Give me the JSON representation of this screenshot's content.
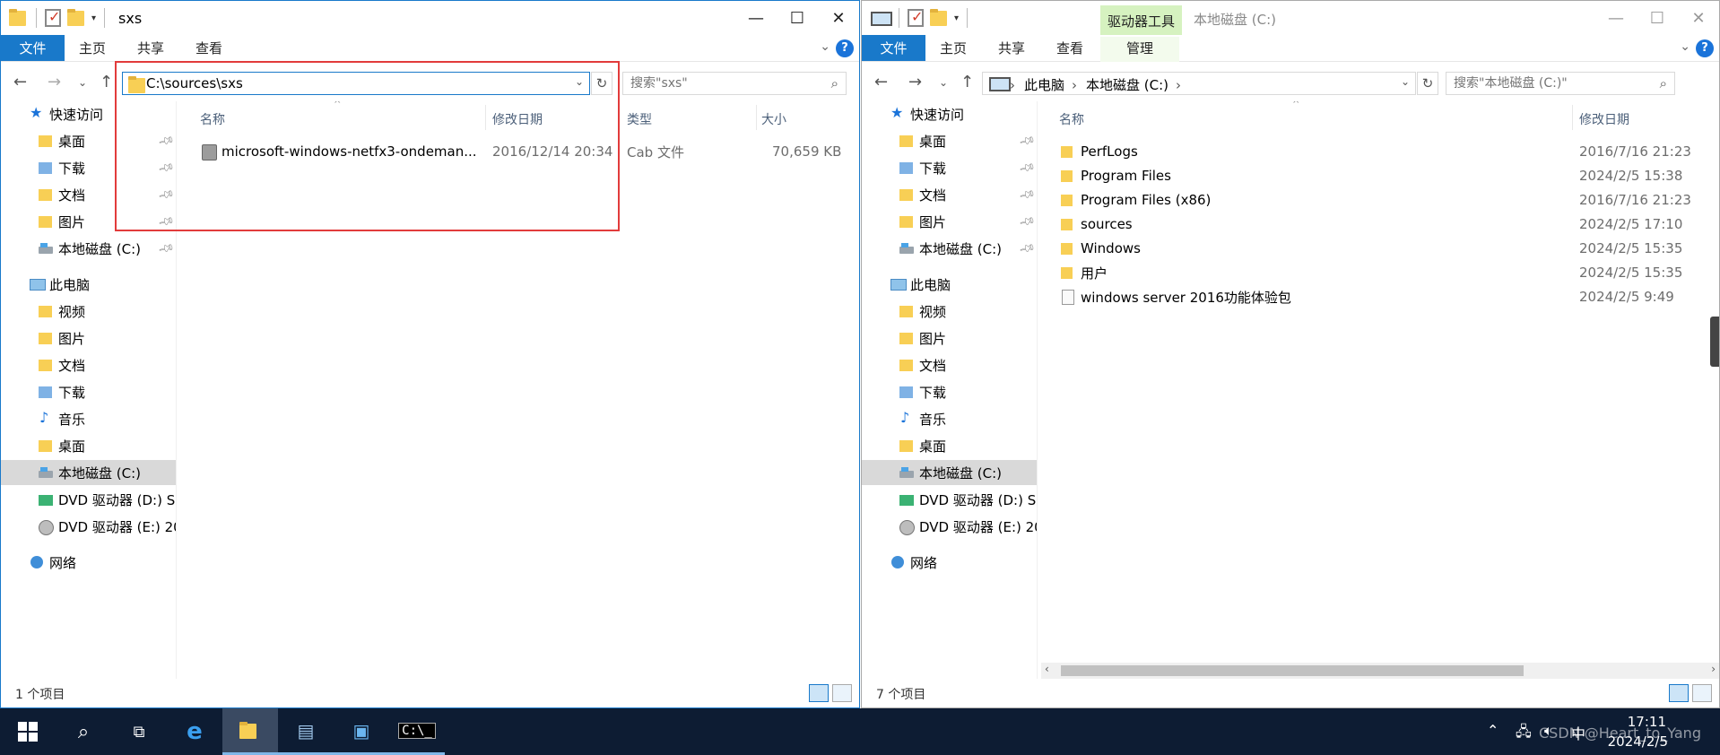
{
  "left": {
    "title": "sxs",
    "tabs": {
      "file": "文件",
      "home": "主页",
      "share": "共享",
      "view": "查看"
    },
    "address": "C:\\sources\\sxs",
    "search_placeholder": "搜索\"sxs\"",
    "nav": {
      "quick_access": "快速访问",
      "quick": [
        "桌面",
        "下载",
        "文档",
        "图片",
        "本地磁盘 (C:)"
      ],
      "this_pc": "此电脑",
      "pc": [
        "视频",
        "图片",
        "文档",
        "下载",
        "音乐",
        "桌面",
        "本地磁盘 (C:)",
        "DVD 驱动器 (D:) SS",
        "DVD 驱动器 (E:) 20"
      ],
      "network": "网络"
    },
    "columns": {
      "name": "名称",
      "modified": "修改日期",
      "type": "类型",
      "size": "大小"
    },
    "files": [
      {
        "name": "microsoft-windows-netfx3-ondeman...",
        "modified": "2016/12/14 20:34",
        "type": "Cab 文件",
        "size": "70,659 KB"
      }
    ],
    "status": "1 个项目"
  },
  "right": {
    "title": "本地磁盘 (C:)",
    "context_tab": "驱动器工具",
    "tabs": {
      "file": "文件",
      "home": "主页",
      "share": "共享",
      "view": "查看",
      "manage": "管理"
    },
    "breadcrumb": [
      "此电脑",
      "本地磁盘 (C:)"
    ],
    "search_placeholder": "搜索\"本地磁盘 (C:)\"",
    "nav": {
      "quick_access": "快速访问",
      "quick": [
        "桌面",
        "下载",
        "文档",
        "图片",
        "本地磁盘 (C:)"
      ],
      "this_pc": "此电脑",
      "pc": [
        "视频",
        "图片",
        "文档",
        "下载",
        "音乐",
        "桌面",
        "本地磁盘 (C:)",
        "DVD 驱动器 (D:) SS",
        "DVD 驱动器 (E:) 20"
      ],
      "network": "网络"
    },
    "columns": {
      "name": "名称",
      "modified": "修改日期"
    },
    "files": [
      {
        "name": "PerfLogs",
        "modified": "2016/7/16 21:23"
      },
      {
        "name": "Program Files",
        "modified": "2024/2/5 15:38"
      },
      {
        "name": "Program Files (x86)",
        "modified": "2016/7/16 21:23"
      },
      {
        "name": "sources",
        "modified": "2024/2/5 17:10"
      },
      {
        "name": "Windows",
        "modified": "2024/2/5 15:35"
      },
      {
        "name": "用户",
        "modified": "2024/2/5 15:35"
      },
      {
        "name": "windows server 2016功能体验包",
        "modified": "2024/2/5 9:49"
      }
    ],
    "status": "7 个项目"
  },
  "taskbar": {
    "time": "17:11",
    "date": "2024/2/5",
    "watermark": "CSDN @Heart_to_Yang"
  },
  "colors": {
    "accent": "#1979ca",
    "highlight": "#e23b3b",
    "taskbar": "#0d1c33"
  }
}
